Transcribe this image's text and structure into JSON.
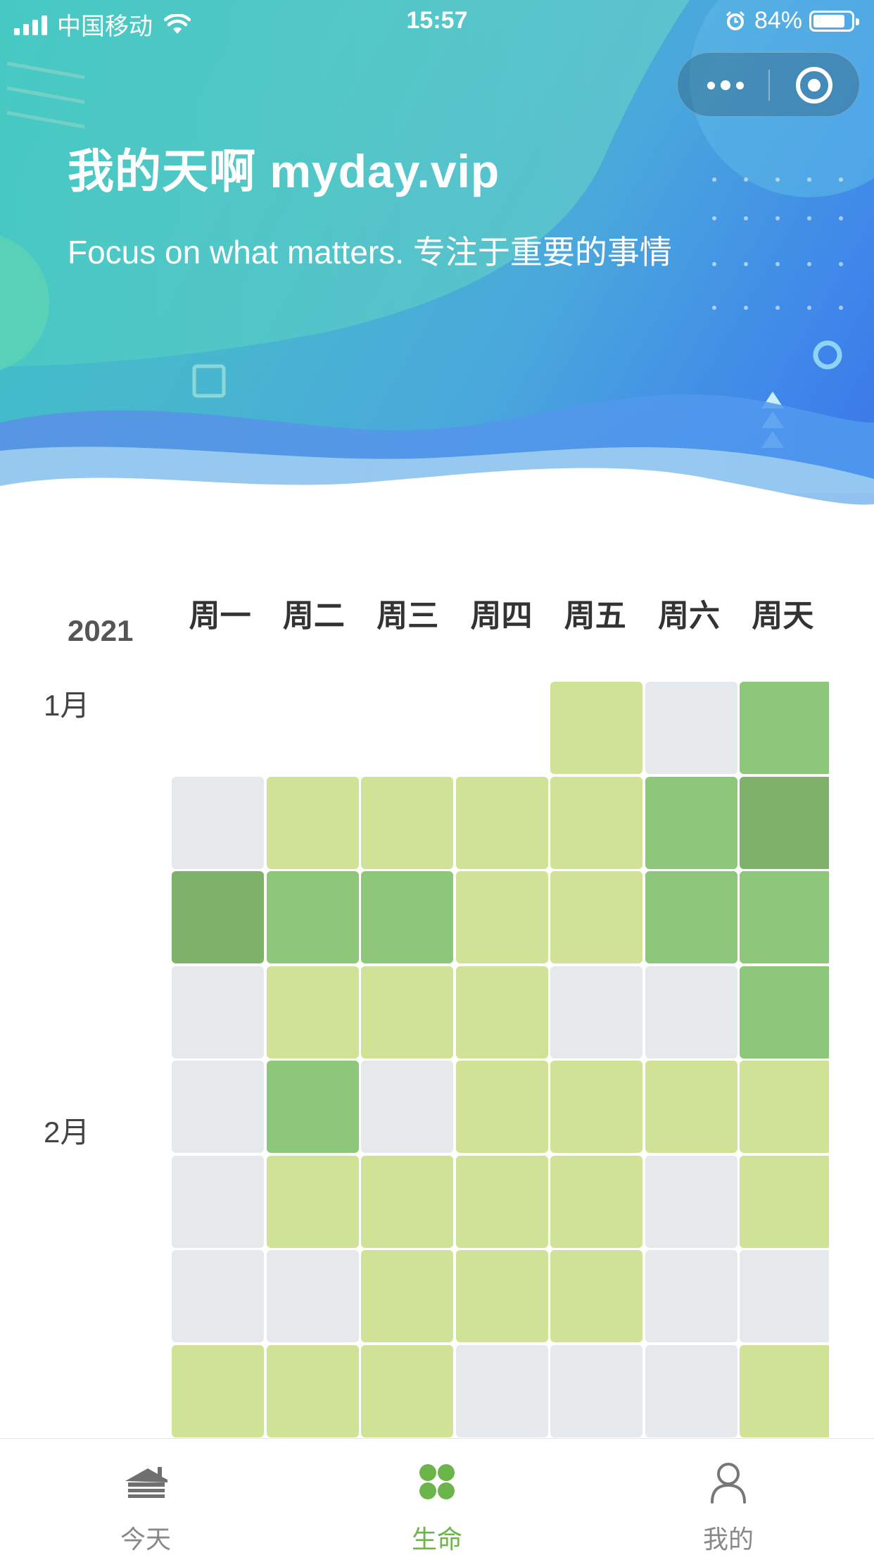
{
  "status_bar": {
    "carrier": "中国移动",
    "time": "15:57",
    "battery": "84%"
  },
  "header": {
    "title": "我的天啊 myday.vip",
    "subtitle": "Focus on what matters. 专注于重要的事情"
  },
  "calendar": {
    "year": "2021",
    "weekdays": [
      "周一",
      "周二",
      "周三",
      "周四",
      "周五",
      "周六",
      "周天"
    ],
    "months": [
      "1月",
      "2月"
    ],
    "levels_legend": {
      "0": "#e6e9ec",
      "1": "#cfe296",
      "2": "#8dc779",
      "3": "#7eb26b"
    },
    "weeks": [
      [
        null,
        null,
        null,
        null,
        1,
        0,
        2
      ],
      [
        0,
        1,
        1,
        1,
        1,
        2,
        3
      ],
      [
        3,
        2,
        2,
        1,
        1,
        2,
        2
      ],
      [
        0,
        1,
        1,
        1,
        0,
        0,
        2
      ],
      [
        0,
        2,
        0,
        1,
        1,
        1,
        1
      ],
      [
        0,
        1,
        1,
        1,
        1,
        0,
        1
      ],
      [
        0,
        0,
        1,
        1,
        1,
        0,
        0
      ],
      [
        1,
        1,
        1,
        0,
        0,
        0,
        1
      ]
    ]
  },
  "tabbar": {
    "tabs": [
      {
        "label": "今天",
        "icon": "house-icon",
        "active": false
      },
      {
        "label": "生命",
        "icon": "life-icon",
        "active": true
      },
      {
        "label": "我的",
        "icon": "person-icon",
        "active": false
      }
    ],
    "active_color": "#6cb54b",
    "inactive_color": "#888888"
  }
}
